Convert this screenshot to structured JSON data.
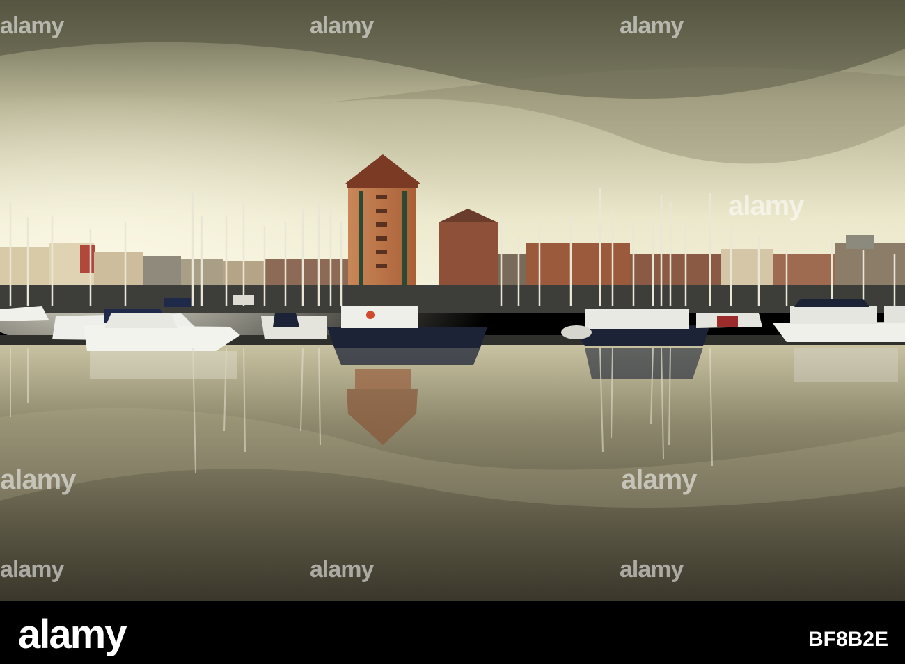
{
  "watermark": {
    "text": "alamy"
  },
  "footer": {
    "logo": "alamy",
    "image_id": "BF8B2E"
  },
  "colors": {
    "sky_top": "#6b6a52",
    "sky_glow": "#f4f1d6",
    "water": "#4f4b3a",
    "tower": "#b86a3e",
    "roof": "#7a3a24",
    "boat_white": "#f3f3ee",
    "boat_navy": "#1c2336"
  }
}
